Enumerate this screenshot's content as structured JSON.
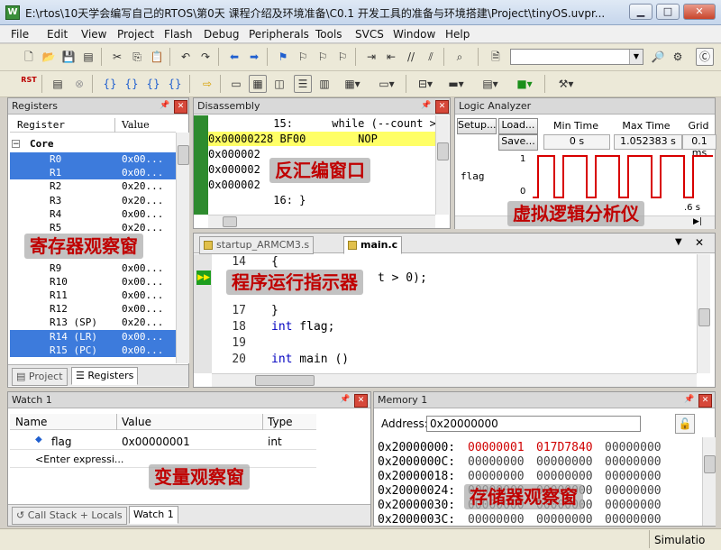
{
  "window": {
    "title": "E:\\rtos\\10天学会编写自己的RTOS\\第0天 课程介绍及环境准备\\C0.1 开发工具的准备与环境搭建\\Project\\tinyOS.uvpr...",
    "app_icon": "keil-uvision-icon"
  },
  "menu": [
    "File",
    "Edit",
    "View",
    "Project",
    "Flash",
    "Debug",
    "Peripherals",
    "Tools",
    "SVCS",
    "Window",
    "Help"
  ],
  "toolbar": {
    "rst_label": "RST"
  },
  "registers": {
    "title": "Registers",
    "col_register": "Register",
    "col_value": "Value",
    "group": "Core",
    "rows": [
      {
        "name": "R0",
        "value": "0x00...",
        "selected": true
      },
      {
        "name": "R1",
        "value": "0x00...",
        "selected": true
      },
      {
        "name": "R2",
        "value": "0x20...",
        "selected": false
      },
      {
        "name": "R3",
        "value": "0x20...",
        "selected": false
      },
      {
        "name": "R4",
        "value": "0x00...",
        "selected": false
      },
      {
        "name": "R5",
        "value": "0x20...",
        "selected": false
      },
      {
        "name": "R9",
        "value": "0x00...",
        "selected": false
      },
      {
        "name": "R10",
        "value": "0x00...",
        "selected": false
      },
      {
        "name": "R11",
        "value": "0x00...",
        "selected": false
      },
      {
        "name": "R12",
        "value": "0x00...",
        "selected": false
      },
      {
        "name": "R13 (SP)",
        "value": "0x20...",
        "selected": false
      },
      {
        "name": "R14 (LR)",
        "value": "0x00...",
        "selected": true
      },
      {
        "name": "R15 (PC)",
        "value": "0x00...",
        "selected": true
      }
    ],
    "tab_project": "Project",
    "tab_registers": "Registers",
    "annotation": "寄存器观察窗"
  },
  "disassembly": {
    "title": "Disassembly",
    "lines": [
      {
        "text": "          15:      while (--count > 0",
        "highlight": false,
        "arrow": false
      },
      {
        "text": "0x00000228 BF00        NOP",
        "highlight": true,
        "arrow": false
      },
      {
        "text": "0x000002",
        "highlight": false,
        "arrow": false
      },
      {
        "text": "0x000002",
        "highlight": false,
        "arrow": false
      },
      {
        "text": "0x000002",
        "highlight": false,
        "arrow": true
      },
      {
        "text": "          16: }",
        "highlight": false,
        "arrow": false
      }
    ],
    "annotation": "反汇编窗口"
  },
  "logic_analyzer": {
    "title": "Logic Analyzer",
    "setup_button": "Setup...",
    "load_button": "Load...",
    "save_button": "Save...",
    "min_time_label": "Min Time",
    "max_time_label": "Max Time",
    "grid_label": "Grid",
    "min_time": "0 s",
    "max_time": "1.052383 s",
    "grid": "0.1 ms",
    "signal": "flag",
    "level_high": "1",
    "level_low": "0",
    "time_marker": ".6 s",
    "annotation": "虚拟逻辑分析仪"
  },
  "editor": {
    "tabs": [
      {
        "label": "startup_ARMCM3.s",
        "active": false
      },
      {
        "label": "main.c",
        "active": true
      }
    ],
    "lines": [
      {
        "num": "14",
        "code": "{"
      },
      {
        "num": "",
        "code": "t > 0);"
      },
      {
        "num": "17",
        "code": "}"
      },
      {
        "num": "18",
        "code": "int flag;"
      },
      {
        "num": "19",
        "code": ""
      },
      {
        "num": "20",
        "code": "int main ()"
      }
    ],
    "annotation": "程序运行指示器"
  },
  "watch": {
    "title": "Watch 1",
    "col_name": "Name",
    "col_value": "Value",
    "col_type": "Type",
    "rows": [
      {
        "name": "flag",
        "value": "0x00000001",
        "type": "int"
      },
      {
        "name": "<Enter expressi...",
        "value": "",
        "type": ""
      }
    ],
    "tab_callstack": "Call Stack + Locals",
    "tab_watch": "Watch 1",
    "annotation": "变量观察窗"
  },
  "memory": {
    "title": "Memory 1",
    "address_label": "Address:",
    "address_value": "0x20000000",
    "lines": [
      {
        "addr": "0x20000000:",
        "w1": "00000001",
        "w2": "017D7840",
        "w3": "00000000"
      },
      {
        "addr": "0x2000000C:",
        "w1": "00000000",
        "w2": "00000000",
        "w3": "00000000"
      },
      {
        "addr": "0x20000018:",
        "w1": "00000000",
        "w2": "00000000",
        "w3": "00000000"
      },
      {
        "addr": "0x20000024:",
        "w1": "00000000",
        "w2": "00000000",
        "w3": "00000000"
      },
      {
        "addr": "0x20000030:",
        "w1": "00000000",
        "w2": "00000000",
        "w3": "00000000"
      },
      {
        "addr": "0x2000003C:",
        "w1": "00000000",
        "w2": "00000000",
        "w3": "00000000"
      }
    ],
    "annotation": "存储器观察窗"
  },
  "status": {
    "mode": "Simulatio"
  },
  "colors": {
    "accent_red": "#c00000",
    "selection": "#3d7bdc",
    "waveform": "#d80000",
    "exec_line": "#ffff66",
    "keyword": "#0000c0",
    "changed_value": "#d00000",
    "run_indicator": "#1e9e1e"
  }
}
